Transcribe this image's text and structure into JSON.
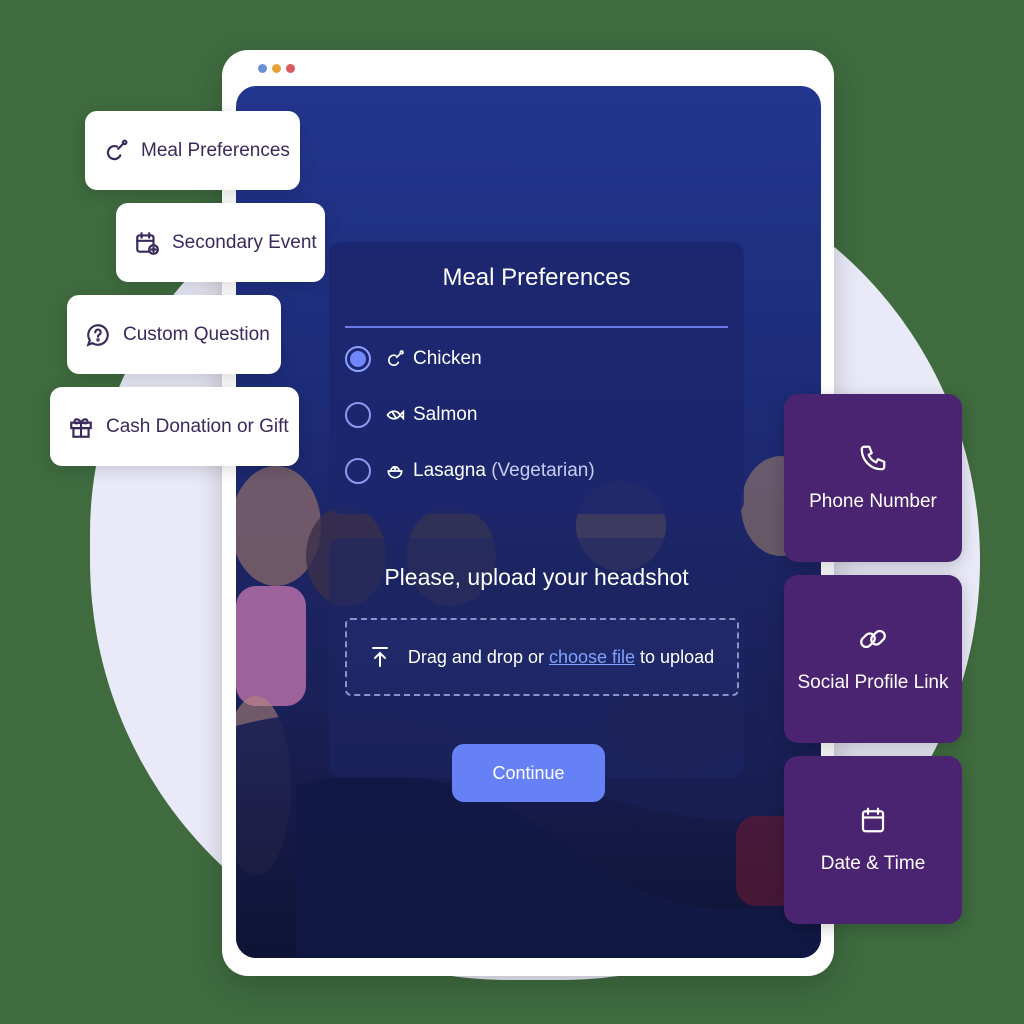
{
  "window": {
    "dot_colors": [
      "#6b8fd6",
      "#e8a23a",
      "#d95a5a"
    ]
  },
  "meal_preferences": {
    "title": "Meal Preferences",
    "options": [
      {
        "label": "Chicken",
        "note": "",
        "icon": "chicken-icon",
        "selected": true
      },
      {
        "label": "Salmon",
        "note": "",
        "icon": "fish-icon",
        "selected": false
      },
      {
        "label": "Lasagna",
        "note": "(Vegetarian)",
        "icon": "bowl-icon",
        "selected": false
      }
    ]
  },
  "upload": {
    "title": "Please, upload your headshot",
    "prefix": "Drag and drop or",
    "link": "choose file",
    "suffix": "to upload",
    "icon": "upload-icon"
  },
  "continue_label": "Continue",
  "left_cards": [
    {
      "label": "Meal Preferences",
      "icon": "chicken-icon"
    },
    {
      "label": "Secondary Event",
      "icon": "calendar-plus-icon"
    },
    {
      "label": "Custom Question",
      "icon": "question-bubble-icon"
    },
    {
      "label": "Cash Donation or Gift",
      "icon": "gift-icon"
    }
  ],
  "right_cards": [
    {
      "label": "Phone Number",
      "icon": "phone-icon"
    },
    {
      "label": "Social Profile Link",
      "icon": "link-icon"
    },
    {
      "label": "Date & Time",
      "icon": "calendar-icon"
    }
  ],
  "colors": {
    "accent": "#6680f5",
    "purple_card": "#4a2470",
    "card_text": "#3a2a5c",
    "link": "#7fa2ff"
  }
}
